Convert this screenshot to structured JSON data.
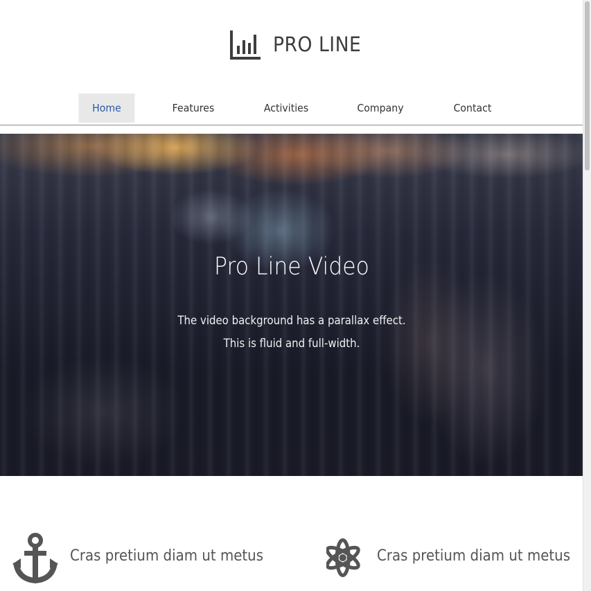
{
  "brand": {
    "name": "PRO LINE",
    "icon": "bar-chart-icon"
  },
  "nav": {
    "items": [
      {
        "label": "Home",
        "active": true
      },
      {
        "label": "Features",
        "active": false
      },
      {
        "label": "Activities",
        "active": false
      },
      {
        "label": "Company",
        "active": false
      },
      {
        "label": "Contact",
        "active": false
      }
    ]
  },
  "hero": {
    "title": "Pro Line Video",
    "line1": "The video background has a parallax effect.",
    "line2": "This is fluid and full-width."
  },
  "features": [
    {
      "icon": "anchor-icon",
      "title": "Cras pretium diam ut metus"
    },
    {
      "icon": "atom-icon",
      "title": "Cras pretium diam ut metus"
    }
  ],
  "colors": {
    "nav_active_text": "#2a5aa8",
    "nav_active_bg": "#e8e8e8",
    "icon_color": "#555555"
  }
}
